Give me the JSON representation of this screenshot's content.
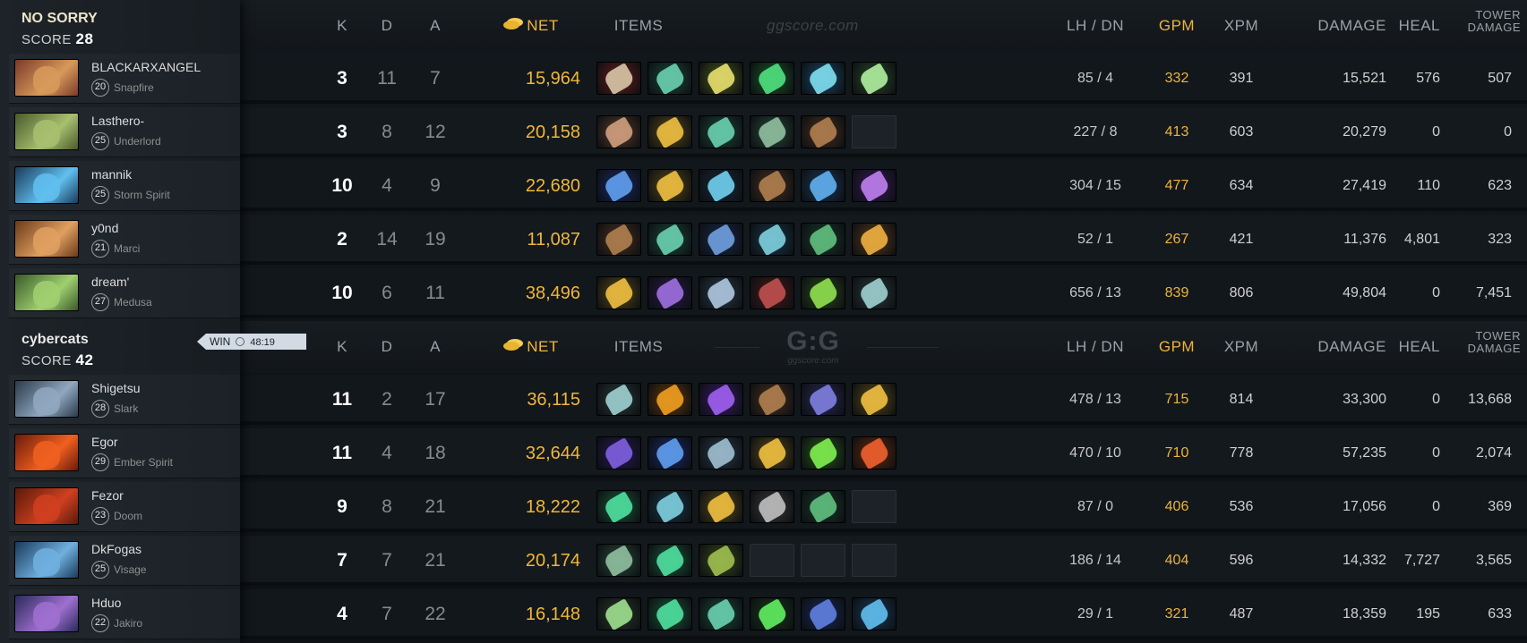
{
  "colors": {
    "gold": "#f0b73a",
    "gpm": "#eeb33a"
  },
  "headers": {
    "k": "K",
    "d": "D",
    "a": "A",
    "net": "NET",
    "items": "ITEMS",
    "lhdn": "LH  /  DN",
    "gpm": "GPM",
    "xpm": "XPM",
    "damage": "DAMAGE",
    "heal": "HEAL",
    "tower_1": "TOWER",
    "tower_2": "DAMAGE"
  },
  "watermark": {
    "text": "ggscore.com",
    "logo": "G:G",
    "logo_sub": "ggscore.com"
  },
  "teams": [
    {
      "name": "NO SORRY",
      "score_label": "SCORE",
      "score": "28",
      "players": [
        {
          "name": "BLACKARXANGEL",
          "level": "20",
          "hero": "Snapfire",
          "k": "3",
          "d": "11",
          "a": "7",
          "net": "15,964",
          "lhdn": "85  /  4",
          "gpm": "332",
          "xpm": "391",
          "damage": "15,521",
          "heal": "576",
          "tower": "507",
          "hero_colors": [
            "#7a3a2a",
            "#d89a5a"
          ],
          "items": [
            [
              "#6b1d1d",
              "#d8c8a8"
            ],
            [
              "#1c4a3a",
              "#6ad0b0"
            ],
            [
              "#4a5a1a",
              "#e8e070"
            ],
            [
              "#1a5a2a",
              "#50e080"
            ],
            [
              "#1a4a6a",
              "#80e0f0"
            ],
            [
              "#2a4a2a",
              "#b0f0a0"
            ]
          ]
        },
        {
          "name": "Lasthero-",
          "level": "25",
          "hero": "Underlord",
          "k": "3",
          "d": "8",
          "a": "12",
          "net": "20,158",
          "lhdn": "227  /  8",
          "gpm": "413",
          "xpm": "603",
          "damage": "20,279",
          "heal": "0",
          "tower": "0",
          "hero_colors": [
            "#4a5a2a",
            "#a8c070"
          ],
          "items": [
            [
              "#5a3a2a",
              "#d0a080"
            ],
            [
              "#5a4a1a",
              "#f0c040"
            ],
            [
              "#1c4a3a",
              "#6ad0b0"
            ],
            [
              "#2a4a3a",
              "#90c0a0"
            ],
            [
              "#4a3020",
              "#b08050"
            ],
            null
          ]
        },
        {
          "name": "mannik",
          "level": "25",
          "hero": "Storm Spirit",
          "k": "10",
          "d": "4",
          "a": "9",
          "net": "22,680",
          "lhdn": "304  /  15",
          "gpm": "477",
          "xpm": "634",
          "damage": "27,419",
          "heal": "110",
          "tower": "623",
          "hero_colors": [
            "#1a3a5a",
            "#60c0f0"
          ],
          "items": [
            [
              "#1a2a6a",
              "#60a0f0"
            ],
            [
              "#5a4a1a",
              "#f0c040"
            ],
            [
              "#1a2a3a",
              "#70d0f0"
            ],
            [
              "#4a3020",
              "#b08050"
            ],
            [
              "#1a3a5a",
              "#60b0f0"
            ],
            [
              "#3a1a5a",
              "#c080f0"
            ]
          ]
        },
        {
          "name": "y0nd",
          "level": "21",
          "hero": "Marci",
          "k": "2",
          "d": "14",
          "a": "19",
          "net": "11,087",
          "lhdn": "52  /  1",
          "gpm": "267",
          "xpm": "421",
          "damage": "11,376",
          "heal": "4,801",
          "tower": "323",
          "hero_colors": [
            "#6a3a1a",
            "#e0a060"
          ],
          "items": [
            [
              "#4a3020",
              "#b08050"
            ],
            [
              "#1c4a3a",
              "#6ad0b0"
            ],
            [
              "#1a2a4a",
              "#70a0e0"
            ],
            [
              "#1a3a4a",
              "#80d0e0"
            ],
            [
              "#1a3a2a",
              "#60c080"
            ],
            [
              "#5a3a1a",
              "#f0b040"
            ]
          ]
        },
        {
          "name": "dream'",
          "level": "27",
          "hero": "Medusa",
          "k": "10",
          "d": "6",
          "a": "11",
          "net": "38,496",
          "lhdn": "656  /  13",
          "gpm": "839",
          "xpm": "806",
          "damage": "49,804",
          "heal": "0",
          "tower": "7,451",
          "hero_colors": [
            "#3a5a2a",
            "#a0d070"
          ],
          "items": [
            [
              "#5a4a1a",
              "#f0c040"
            ],
            [
              "#2a1a4a",
              "#a070e0"
            ],
            [
              "#2a3a4a",
              "#b0c8e0"
            ],
            [
              "#4a1a1a",
              "#c05050"
            ],
            [
              "#2a4a1a",
              "#90e050"
            ],
            [
              "#2a3a3a",
              "#a0d0d0"
            ]
          ]
        }
      ]
    },
    {
      "name": "cybercats",
      "score_label": "SCORE",
      "score": "42",
      "win_label": "WIN",
      "duration": "48:19",
      "players": [
        {
          "name": "Shigetsu",
          "level": "28",
          "hero": "Slark",
          "k": "11",
          "d": "2",
          "a": "17",
          "net": "36,115",
          "lhdn": "478  /  13",
          "gpm": "715",
          "xpm": "814",
          "damage": "33,300",
          "heal": "0",
          "tower": "13,668",
          "hero_colors": [
            "#2a3a4a",
            "#90a8c0"
          ],
          "items": [
            [
              "#2a3a3a",
              "#a0d0d0"
            ],
            [
              "#6a3a0a",
              "#f0a020"
            ],
            [
              "#3a1a6a",
              "#a060f0"
            ],
            [
              "#4a3020",
              "#b08050"
            ],
            [
              "#2a2a5a",
              "#8080e0"
            ],
            [
              "#5a4a1a",
              "#f0c040"
            ]
          ]
        },
        {
          "name": "Egor",
          "level": "29",
          "hero": "Ember Spirit",
          "k": "11",
          "d": "4",
          "a": "18",
          "net": "32,644",
          "lhdn": "470  /  10",
          "gpm": "710",
          "xpm": "778",
          "damage": "57,235",
          "heal": "0",
          "tower": "2,074",
          "hero_colors": [
            "#6a1a0a",
            "#f06020"
          ],
          "items": [
            [
              "#2a1a5a",
              "#8060e0"
            ],
            [
              "#1a2a6a",
              "#60a0f0"
            ],
            [
              "#2a3a4a",
              "#a0c0d0"
            ],
            [
              "#5a4a1a",
              "#f0c040"
            ],
            [
              "#2a5a1a",
              "#80f050"
            ],
            [
              "#6a2a0a",
              "#f06030"
            ]
          ]
        },
        {
          "name": "Fezor",
          "level": "23",
          "hero": "Doom",
          "k": "9",
          "d": "8",
          "a": "21",
          "net": "18,222",
          "lhdn": "87  /  0",
          "gpm": "406",
          "xpm": "536",
          "damage": "17,056",
          "heal": "0",
          "tower": "369",
          "hero_colors": [
            "#5a1a0a",
            "#d04020"
          ],
          "items": [
            [
              "#1a5a3a",
              "#50e0a0"
            ],
            [
              "#1a3a4a",
              "#80d0e0"
            ],
            [
              "#5a4a1a",
              "#f0c040"
            ],
            [
              "#3a3a3a",
              "#c0c0c0"
            ],
            [
              "#1a3a2a",
              "#60c080"
            ],
            null
          ]
        },
        {
          "name": "DkFogas",
          "level": "25",
          "hero": "Visage",
          "k": "7",
          "d": "7",
          "a": "21",
          "net": "20,174",
          "lhdn": "186  /  14",
          "gpm": "404",
          "xpm": "596",
          "damage": "14,332",
          "heal": "7,727",
          "tower": "3,565",
          "hero_colors": [
            "#1a3a5a",
            "#70b0e0"
          ],
          "items": [
            [
              "#2a4a3a",
              "#90c0a0"
            ],
            [
              "#1a5a3a",
              "#50e0a0"
            ],
            [
              "#3a4a1a",
              "#a0c050"
            ],
            null,
            null,
            null
          ]
        },
        {
          "name": "Hduo",
          "level": "22",
          "hero": "Jakiro",
          "k": "4",
          "d": "7",
          "a": "22",
          "net": "16,148",
          "lhdn": "29  /  1",
          "gpm": "321",
          "xpm": "487",
          "damage": "18,359",
          "heal": "195",
          "tower": "633",
          "hero_colors": [
            "#2a2a5a",
            "#a070d0"
          ],
          "items": [
            [
              "#2a3a2a",
              "#a0e090"
            ],
            [
              "#1a5a3a",
              "#50e0a0"
            ],
            [
              "#1c4a3a",
              "#6ad0b0"
            ],
            [
              "#1a3a1a",
              "#60f060"
            ],
            [
              "#1a2a5a",
              "#6080e0"
            ],
            [
              "#1a3a5a",
              "#60c0f0"
            ]
          ]
        }
      ]
    }
  ]
}
